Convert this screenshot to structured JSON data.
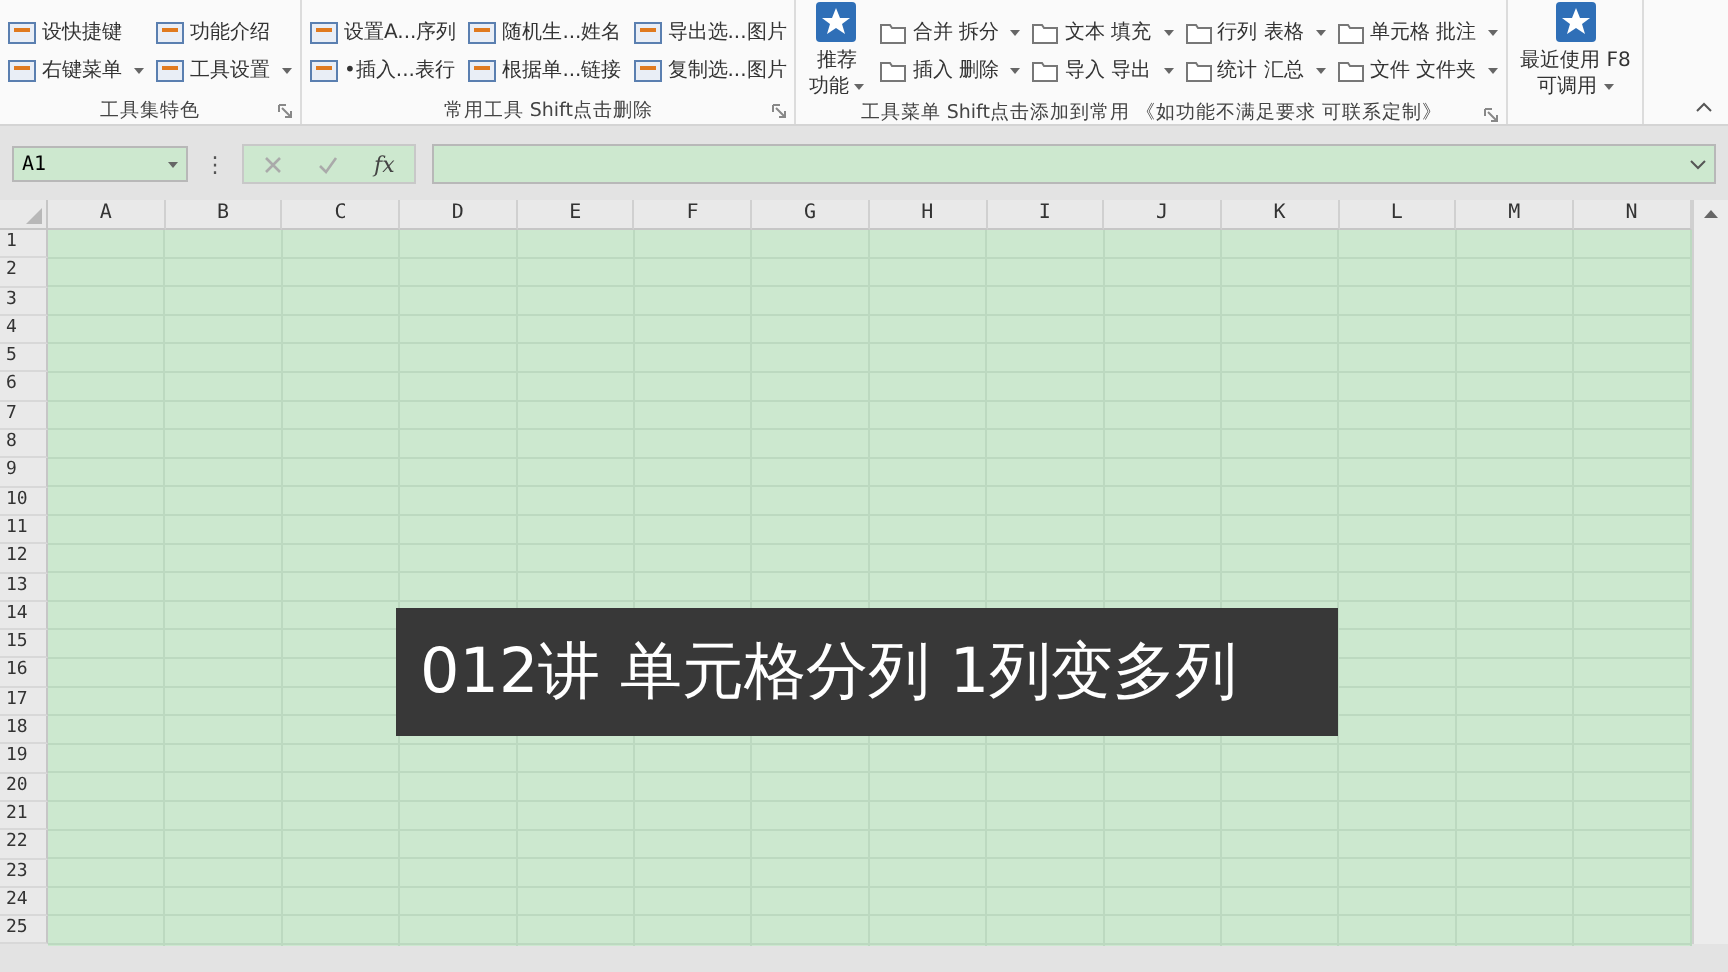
{
  "ribbon": {
    "groups": [
      {
        "label": "工具集特色",
        "launcher": true,
        "columns": [
          {
            "kind": "stack",
            "items": [
              {
                "label": "设快捷键",
                "dropdown": false
              },
              {
                "label": "右键菜单",
                "dropdown": true
              }
            ]
          },
          {
            "kind": "stack",
            "items": [
              {
                "label": "功能介绍",
                "dropdown": false
              },
              {
                "label": "工具设置",
                "dropdown": true
              }
            ]
          }
        ]
      },
      {
        "label": "常用工具 Shift点击删除",
        "launcher": true,
        "columns": [
          {
            "kind": "stack",
            "items": [
              {
                "label": "设置A...序列",
                "dropdown": false
              },
              {
                "label": "•插入...表行",
                "dropdown": false
              }
            ]
          },
          {
            "kind": "stack",
            "items": [
              {
                "label": "随机生...姓名",
                "dropdown": false
              },
              {
                "label": "根据单...链接",
                "dropdown": false
              }
            ]
          },
          {
            "kind": "stack",
            "items": [
              {
                "label": "导出选...图片",
                "dropdown": false
              },
              {
                "label": "复制选...图片",
                "dropdown": false
              }
            ]
          }
        ]
      },
      {
        "label": "工具菜单 Shift点击添加到常用 《如功能不满足要求 可联系定制》",
        "launcher": true,
        "columns": [
          {
            "kind": "big",
            "lines": [
              "推荐",
              "功能"
            ],
            "dropdown": true
          },
          {
            "kind": "folder-stack",
            "items": [
              {
                "label": "合并 拆分",
                "dropdown": true
              },
              {
                "label": "插入 删除",
                "dropdown": true
              }
            ]
          },
          {
            "kind": "folder-stack",
            "items": [
              {
                "label": "文本 填充",
                "dropdown": true
              },
              {
                "label": "导入 导出",
                "dropdown": true
              }
            ]
          },
          {
            "kind": "folder-stack",
            "items": [
              {
                "label": "行列 表格",
                "dropdown": true
              },
              {
                "label": "统计 汇总",
                "dropdown": true
              }
            ]
          },
          {
            "kind": "folder-stack",
            "items": [
              {
                "label": "单元格 批注",
                "dropdown": true
              },
              {
                "label": "文件 文件夹",
                "dropdown": true
              }
            ]
          }
        ]
      },
      {
        "columns": [
          {
            "kind": "big",
            "lines": [
              "最近使用 F8",
              "可调用"
            ],
            "dropdown": true
          }
        ]
      }
    ]
  },
  "formula_bar": {
    "name_box": "A1",
    "separator": "⋮",
    "function_label": "fx"
  },
  "sheet": {
    "columns": [
      "A",
      "B",
      "C",
      "D",
      "E",
      "F",
      "G",
      "H",
      "I",
      "J",
      "K",
      "L",
      "M",
      "N"
    ],
    "rows": [
      "1",
      "2",
      "3",
      "4",
      "5",
      "6",
      "7",
      "8",
      "9",
      "10",
      "11",
      "12",
      "13",
      "14",
      "15",
      "16",
      "17",
      "18",
      "19",
      "20",
      "21",
      "22",
      "23",
      "24",
      "25"
    ]
  },
  "caption": "012讲 单元格分列 1列变多列"
}
